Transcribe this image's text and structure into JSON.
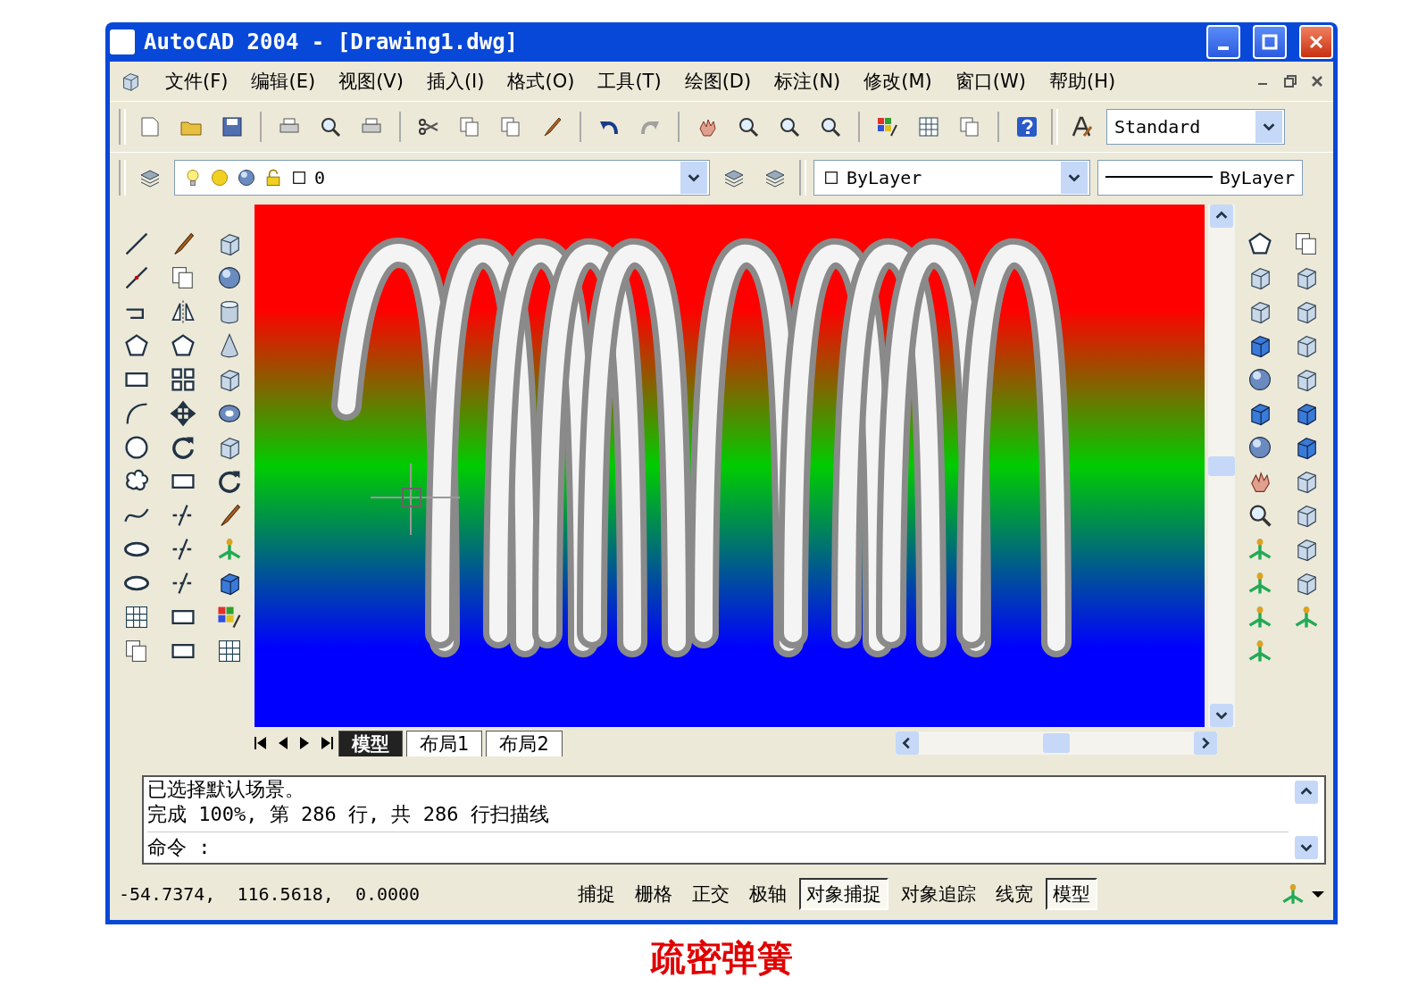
{
  "window": {
    "title": "AutoCAD 2004 - [Drawing1.dwg]"
  },
  "menu": [
    "文件(F)",
    "编辑(E)",
    "视图(V)",
    "插入(I)",
    "格式(O)",
    "工具(T)",
    "绘图(D)",
    "标注(N)",
    "修改(M)",
    "窗口(W)",
    "帮助(H)"
  ],
  "toolbar": {
    "text_style": "Standard",
    "layer": "0",
    "color_setting": "ByLayer",
    "linetype": "ByLayer"
  },
  "layout_tabs": [
    {
      "label": "模型",
      "selected": true
    },
    {
      "label": "布局1",
      "selected": false
    },
    {
      "label": "布局2",
      "selected": false
    }
  ],
  "command": {
    "history": [
      "已选择默认场景。",
      "完成 100%, 第 286 行, 共 286 行扫描线"
    ],
    "prompt": "命令 :"
  },
  "status_bar": {
    "coordinates": "-54.7374,  116.5618,  0.0000",
    "toggles": [
      {
        "label": "捕捉",
        "on": false
      },
      {
        "label": "栅格",
        "on": false
      },
      {
        "label": "正交",
        "on": false
      },
      {
        "label": "极轴",
        "on": false
      },
      {
        "label": "对象捕捉",
        "on": true
      },
      {
        "label": "对象追踪",
        "on": false
      },
      {
        "label": "线宽",
        "on": false
      },
      {
        "label": "模型",
        "on": true
      }
    ]
  },
  "caption": "疏密弹簧"
}
